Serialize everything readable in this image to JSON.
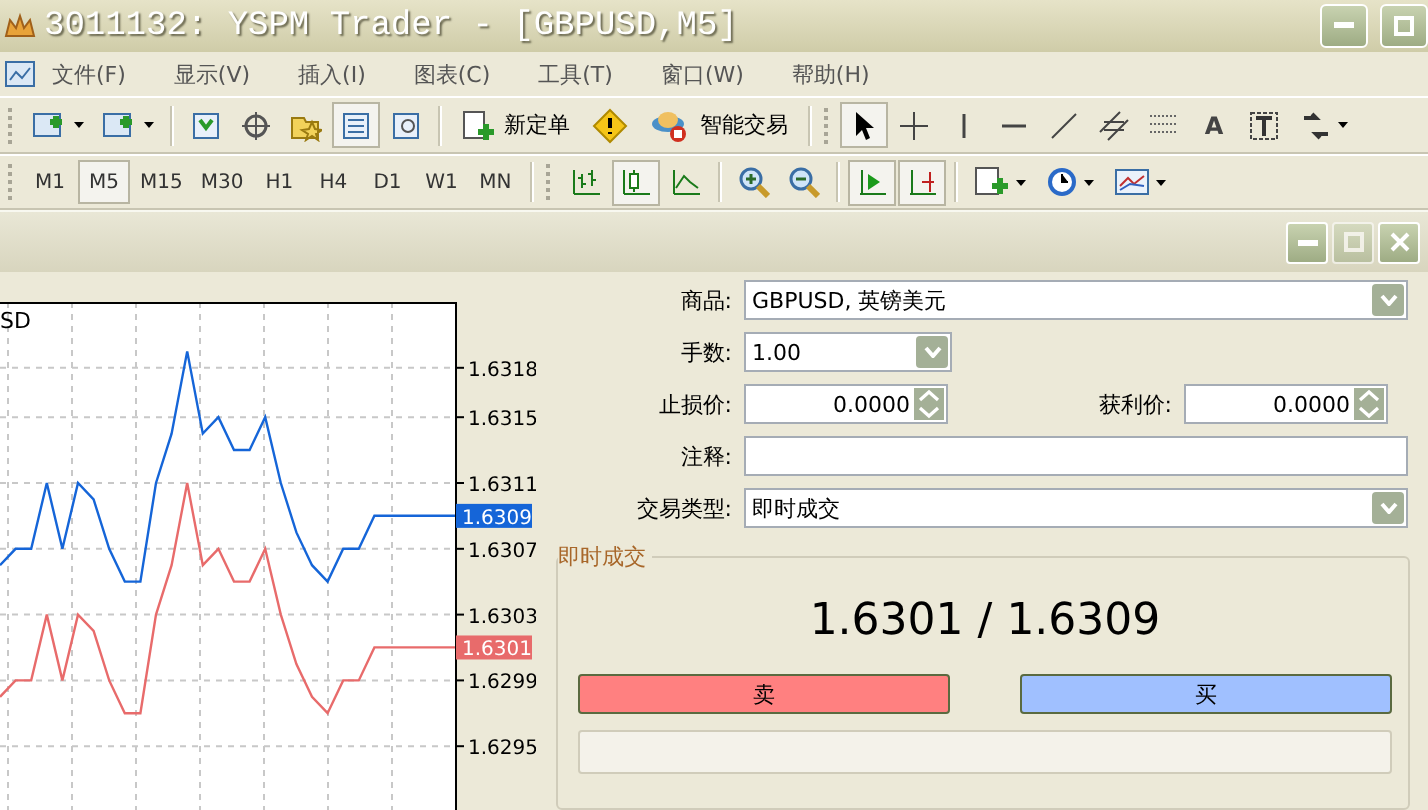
{
  "window": {
    "title": "3011132: YSPM Trader - [GBPUSD,M5]"
  },
  "menu": [
    "文件(F)",
    "显示(V)",
    "插入(I)",
    "图表(C)",
    "工具(T)",
    "窗口(W)",
    "帮助(H)"
  ],
  "toolbar": {
    "new_order": "新定单",
    "expert_advisors": "智能交易",
    "text_tool": "A"
  },
  "timeframes": [
    {
      "label": "M1",
      "selected": false
    },
    {
      "label": "M5",
      "selected": true
    },
    {
      "label": "M15",
      "selected": false
    },
    {
      "label": "M30",
      "selected": false
    },
    {
      "label": "H1",
      "selected": false
    },
    {
      "label": "H4",
      "selected": false
    },
    {
      "label": "D1",
      "selected": false
    },
    {
      "label": "W1",
      "selected": false
    },
    {
      "label": "MN",
      "selected": false
    }
  ],
  "chart": {
    "title": "SD",
    "price_labels": [
      {
        "text": "1.6309",
        "color": "#1565d8"
      },
      {
        "text": "1.6301",
        "color": "#e86b6b"
      }
    ],
    "chart_data": {
      "type": "line",
      "grid": true,
      "categories": [
        null,
        null,
        null,
        null,
        null,
        null,
        null,
        null,
        null,
        null,
        null,
        null,
        null,
        null,
        null,
        null,
        null,
        null,
        null,
        null,
        null,
        null,
        null,
        null,
        null,
        null
      ],
      "ylim": [
        1.6291,
        1.6322
      ],
      "yticks": [
        {
          "value": 1.6318,
          "label": "1.6318"
        },
        {
          "value": 1.6315,
          "label": "1.6315"
        },
        {
          "value": 1.6311,
          "label": "1.6311"
        },
        {
          "value": 1.6307,
          "label": "1.6307"
        },
        {
          "value": 1.6303,
          "label": "1.6303"
        },
        {
          "value": 1.6299,
          "label": "1.6299"
        },
        {
          "value": 1.6295,
          "label": "1.6295"
        }
      ],
      "series": [
        {
          "color": "#1565d8",
          "values": [
            1.6306,
            1.6307,
            1.6307,
            1.6311,
            1.6307,
            1.6311,
            1.631,
            1.6307,
            1.6305,
            1.6305,
            1.6311,
            1.6314,
            1.6319,
            1.6314,
            1.6315,
            1.6313,
            1.6313,
            1.6315,
            1.6311,
            1.6308,
            1.6306,
            1.6305,
            1.6307,
            1.6307,
            1.6309,
            1.6309
          ]
        },
        {
          "color": "#e86b6b",
          "values": [
            1.6298,
            1.6299,
            1.6299,
            1.6303,
            1.6299,
            1.6303,
            1.6302,
            1.6299,
            1.6297,
            1.6297,
            1.6303,
            1.6306,
            1.6311,
            1.6306,
            1.6307,
            1.6305,
            1.6305,
            1.6307,
            1.6303,
            1.63,
            1.6298,
            1.6297,
            1.6299,
            1.6299,
            1.6301,
            1.6301
          ]
        }
      ]
    }
  },
  "order": {
    "symbol": {
      "label": "商品:",
      "value": "GBPUSD, 英镑美元"
    },
    "volume": {
      "label": "手数:",
      "value": "1.00"
    },
    "stop_loss": {
      "label": "止损价:",
      "value": "0.0000"
    },
    "take_profit": {
      "label": "获利价:",
      "value": "0.0000"
    },
    "comment": {
      "label": "注释:"
    },
    "type": {
      "label": "交易类型:",
      "value": "即时成交"
    },
    "group_title": "即时成交",
    "quote": "1.6301 / 1.6309",
    "sell": "卖",
    "buy": "买"
  }
}
